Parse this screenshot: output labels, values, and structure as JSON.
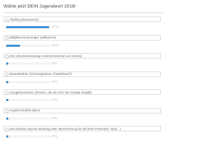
{
  "poll": {
    "title": "Wähle jetzt DEIN Jugendwort 2016!",
    "options": [
      {
        "label": "Tinding (Browsen/er)",
        "percent": 97,
        "result": "(97%)"
      },
      {
        "label": "Willpflanzenanzeiger (selfieerick)",
        "percent": 32,
        "result": "(32%)"
      },
      {
        "label": "Den (Dunkelmomenge Unterschreichen von stress)",
        "percent": 5,
        "result": "(5%)"
      },
      {
        "label": "Bassdetekter (Schweigbasser Charterlead?)",
        "percent": 5,
        "result": "(5%)"
      },
      {
        "label": "Googlebesserbor (Person, die die URL bei Google eingibt)",
        "percent": 4,
        "result": "(4%)"
      },
      {
        "label": "Hopfenmoothie (Bier)",
        "percent": 4,
        "result": "(4%)"
      },
      {
        "label": "Sex (before anyone anything else: Bezeichnung für toll beim Freunden. Nutz.. )",
        "percent": 4,
        "result": "(4%)"
      }
    ],
    "accent_color": "#3d8fd1"
  }
}
